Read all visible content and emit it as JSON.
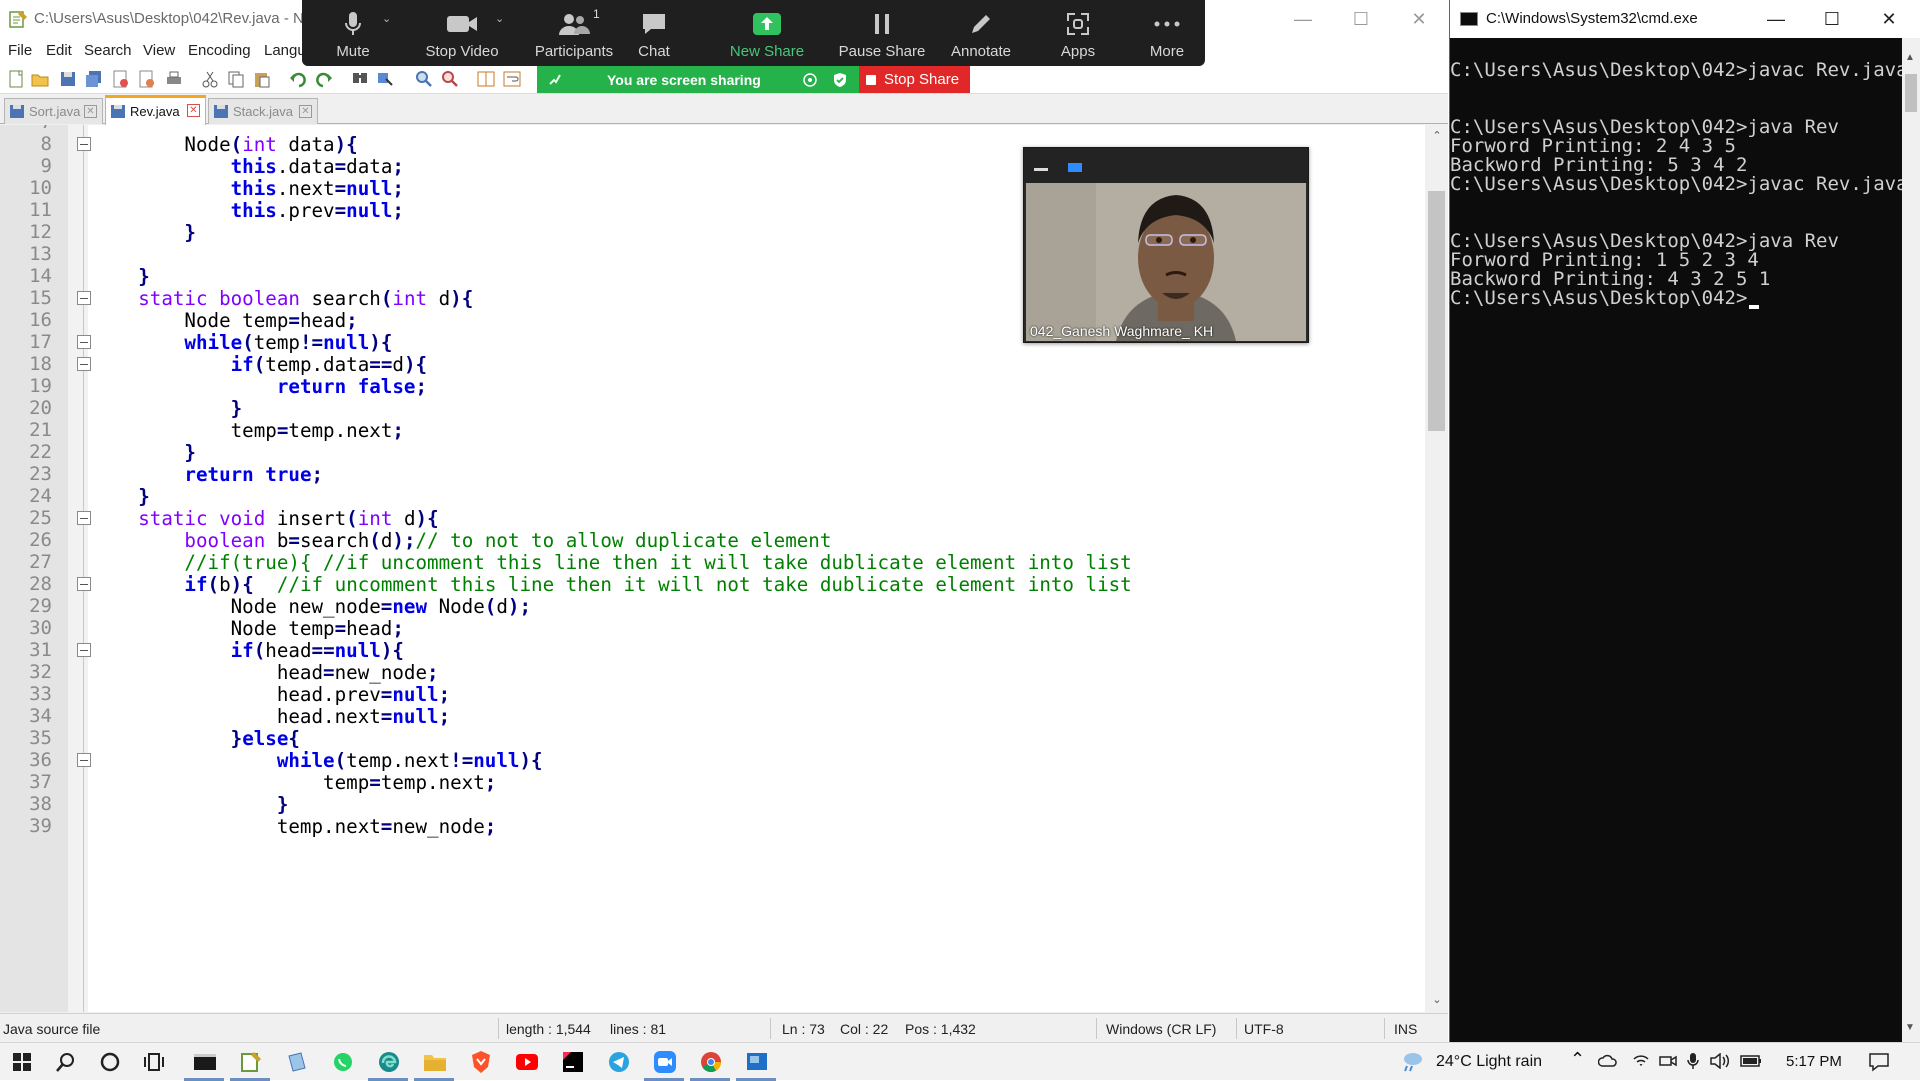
{
  "npp": {
    "title": "C:\\Users\\Asus\\Desktop\\042\\Rev.java - N",
    "menu": [
      "File",
      "Edit",
      "Search",
      "View",
      "Encoding",
      "Langu"
    ],
    "menu_close": "X",
    "tabs": [
      {
        "label": "Sort.java",
        "active": false
      },
      {
        "label": "Rev.java",
        "active": true
      },
      {
        "label": "Stack.java",
        "active": false
      }
    ],
    "line_numbers": [
      "7",
      "8",
      "9",
      "10",
      "11",
      "12",
      "13",
      "14",
      "15",
      "16",
      "17",
      "18",
      "19",
      "20",
      "21",
      "22",
      "23",
      "24",
      "25",
      "26",
      "27",
      "28",
      "29",
      "30",
      "31",
      "32",
      "33",
      "34",
      "35",
      "36",
      "37",
      "38",
      "39"
    ],
    "code_lines": [
      [],
      [
        [
          "t",
          "        Node"
        ],
        [
          "op",
          "("
        ],
        [
          "kp",
          "int"
        ],
        [
          "t",
          " data"
        ],
        [
          "op",
          ")"
        ],
        [
          "op",
          "{"
        ]
      ],
      [
        [
          "t",
          "            "
        ],
        [
          "kb",
          "this"
        ],
        [
          "t",
          ".data"
        ],
        [
          "op",
          "="
        ],
        [
          "t",
          "data"
        ],
        [
          "op",
          ";"
        ]
      ],
      [
        [
          "t",
          "            "
        ],
        [
          "kb",
          "this"
        ],
        [
          "t",
          ".next"
        ],
        [
          "op",
          "="
        ],
        [
          "kb",
          "null"
        ],
        [
          "op",
          ";"
        ]
      ],
      [
        [
          "t",
          "            "
        ],
        [
          "kb",
          "this"
        ],
        [
          "t",
          ".prev"
        ],
        [
          "op",
          "="
        ],
        [
          "kb",
          "null"
        ],
        [
          "op",
          ";"
        ]
      ],
      [
        [
          "t",
          "        "
        ],
        [
          "op",
          "}"
        ]
      ],
      [],
      [
        [
          "t",
          "    "
        ],
        [
          "op",
          "}"
        ]
      ],
      [
        [
          "t",
          "    "
        ],
        [
          "kp",
          "static boolean"
        ],
        [
          "t",
          " search"
        ],
        [
          "op",
          "("
        ],
        [
          "kp",
          "int"
        ],
        [
          "t",
          " d"
        ],
        [
          "op",
          ")"
        ],
        [
          "op",
          "{"
        ]
      ],
      [
        [
          "t",
          "        Node temp"
        ],
        [
          "op",
          "="
        ],
        [
          "t",
          "head"
        ],
        [
          "op",
          ";"
        ]
      ],
      [
        [
          "t",
          "        "
        ],
        [
          "kb",
          "while"
        ],
        [
          "op",
          "("
        ],
        [
          "t",
          "temp"
        ],
        [
          "op",
          "!="
        ],
        [
          "kb",
          "null"
        ],
        [
          "op",
          ")"
        ],
        [
          "op",
          "{"
        ]
      ],
      [
        [
          "t",
          "            "
        ],
        [
          "kb",
          "if"
        ],
        [
          "op",
          "("
        ],
        [
          "t",
          "temp.data"
        ],
        [
          "op",
          "=="
        ],
        [
          "t",
          "d"
        ],
        [
          "op",
          ")"
        ],
        [
          "op",
          "{"
        ]
      ],
      [
        [
          "t",
          "                "
        ],
        [
          "kb",
          "return false"
        ],
        [
          "op",
          ";"
        ]
      ],
      [
        [
          "t",
          "            "
        ],
        [
          "op",
          "}"
        ]
      ],
      [
        [
          "t",
          "            temp"
        ],
        [
          "op",
          "="
        ],
        [
          "t",
          "temp.next"
        ],
        [
          "op",
          ";"
        ]
      ],
      [
        [
          "t",
          "        "
        ],
        [
          "op",
          "}"
        ]
      ],
      [
        [
          "t",
          "        "
        ],
        [
          "kb",
          "return true"
        ],
        [
          "op",
          ";"
        ]
      ],
      [
        [
          "t",
          "    "
        ],
        [
          "op",
          "}"
        ]
      ],
      [
        [
          "t",
          "    "
        ],
        [
          "kp",
          "static void"
        ],
        [
          "t",
          " insert"
        ],
        [
          "op",
          "("
        ],
        [
          "kp",
          "int"
        ],
        [
          "t",
          " d"
        ],
        [
          "op",
          ")"
        ],
        [
          "op",
          "{"
        ]
      ],
      [
        [
          "t",
          "        "
        ],
        [
          "kp",
          "boolean"
        ],
        [
          "t",
          " b"
        ],
        [
          "op",
          "="
        ],
        [
          "t",
          "search"
        ],
        [
          "op",
          "("
        ],
        [
          "t",
          "d"
        ],
        [
          "op",
          ")"
        ],
        [
          "op",
          ";"
        ],
        [
          "c",
          "// to not to allow duplicate element"
        ]
      ],
      [
        [
          "t",
          "        "
        ],
        [
          "c",
          "//if(true){ //if uncomment this line then it will take dublicate element into list"
        ]
      ],
      [
        [
          "t",
          "        "
        ],
        [
          "kb",
          "if"
        ],
        [
          "op",
          "("
        ],
        [
          "t",
          "b"
        ],
        [
          "op",
          ")"
        ],
        [
          "op",
          "{"
        ],
        [
          "t",
          "  "
        ],
        [
          "c",
          "//if uncomment this line then it will not take dublicate element into list"
        ]
      ],
      [
        [
          "t",
          "            Node new_node"
        ],
        [
          "op",
          "="
        ],
        [
          "kb",
          "new"
        ],
        [
          "t",
          " Node"
        ],
        [
          "op",
          "("
        ],
        [
          "t",
          "d"
        ],
        [
          "op",
          ")"
        ],
        [
          "op",
          ";"
        ]
      ],
      [
        [
          "t",
          "            Node temp"
        ],
        [
          "op",
          "="
        ],
        [
          "t",
          "head"
        ],
        [
          "op",
          ";"
        ]
      ],
      [
        [
          "t",
          "            "
        ],
        [
          "kb",
          "if"
        ],
        [
          "op",
          "("
        ],
        [
          "t",
          "head"
        ],
        [
          "op",
          "=="
        ],
        [
          "kb",
          "null"
        ],
        [
          "op",
          ")"
        ],
        [
          "op",
          "{"
        ]
      ],
      [
        [
          "t",
          "                head"
        ],
        [
          "op",
          "="
        ],
        [
          "t",
          "new_node"
        ],
        [
          "op",
          ";"
        ]
      ],
      [
        [
          "t",
          "                head.prev"
        ],
        [
          "op",
          "="
        ],
        [
          "kb",
          "null"
        ],
        [
          "op",
          ";"
        ]
      ],
      [
        [
          "t",
          "                head.next"
        ],
        [
          "op",
          "="
        ],
        [
          "kb",
          "null"
        ],
        [
          "op",
          ";"
        ]
      ],
      [
        [
          "t",
          "            "
        ],
        [
          "op",
          "}"
        ],
        [
          "kb",
          "else"
        ],
        [
          "op",
          "{"
        ]
      ],
      [
        [
          "t",
          "                "
        ],
        [
          "kb",
          "while"
        ],
        [
          "op",
          "("
        ],
        [
          "t",
          "temp.next"
        ],
        [
          "op",
          "!="
        ],
        [
          "kb",
          "null"
        ],
        [
          "op",
          ")"
        ],
        [
          "op",
          "{"
        ]
      ],
      [
        [
          "t",
          "                    temp"
        ],
        [
          "op",
          "="
        ],
        [
          "t",
          "temp.next"
        ],
        [
          "op",
          ";"
        ]
      ],
      [
        [
          "t",
          "                "
        ],
        [
          "op",
          "}"
        ]
      ],
      [
        [
          "t",
          "                temp.next"
        ],
        [
          "op",
          "="
        ],
        [
          "t",
          "new_node"
        ],
        [
          "op",
          ";"
        ]
      ]
    ],
    "fold_lines": [
      "8",
      "15",
      "17",
      "18",
      "25",
      "28",
      "31",
      "36"
    ],
    "status": {
      "file_type": "Java source file",
      "length": "length : 1,544",
      "lines": "lines : 81",
      "ln": "Ln : 73",
      "col": "Col : 22",
      "pos": "Pos : 1,432",
      "eol": "Windows (CR LF)",
      "encoding": "UTF-8",
      "mode": "INS"
    }
  },
  "zoom": {
    "buttons": [
      {
        "label": "Mute",
        "icon": "microphone-icon"
      },
      {
        "label": "Stop Video",
        "icon": "video-camera-icon"
      },
      {
        "label": "Participants",
        "icon": "participants-icon",
        "badge": "1"
      },
      {
        "label": "Chat",
        "icon": "chat-icon"
      },
      {
        "label": "New Share",
        "icon": "share-up-arrow-icon"
      },
      {
        "label": "Pause Share",
        "icon": "pause-icon"
      },
      {
        "label": "Annotate",
        "icon": "pencil-icon"
      },
      {
        "label": "Apps",
        "icon": "apps-icon"
      },
      {
        "label": "More",
        "icon": "ellipsis-icon"
      }
    ],
    "sharing_banner": "You are screen sharing",
    "stop_share": "Stop Share",
    "participant_name": "042_Ganesh Waghmare_ KH",
    "accent_green": "#26b24a",
    "stop_red": "#e02828"
  },
  "cmd": {
    "title": "C:\\Windows\\System32\\cmd.exe",
    "lines": [
      "",
      "C:\\Users\\Asus\\Desktop\\042>javac Rev.java",
      "",
      "",
      "C:\\Users\\Asus\\Desktop\\042>java Rev",
      "Forword Printing: 2 4 3 5",
      "Backword Printing: 5 3 4 2",
      "C:\\Users\\Asus\\Desktop\\042>javac Rev.java",
      "",
      "",
      "C:\\Users\\Asus\\Desktop\\042>java Rev",
      "Forword Printing: 1 5 2 3 4",
      "Backword Printing: 4 3 2 5 1",
      "C:\\Users\\Asus\\Desktop\\042>"
    ]
  },
  "taskbar": {
    "weather": "24°C  Light rain",
    "time": "5:17 PM"
  }
}
